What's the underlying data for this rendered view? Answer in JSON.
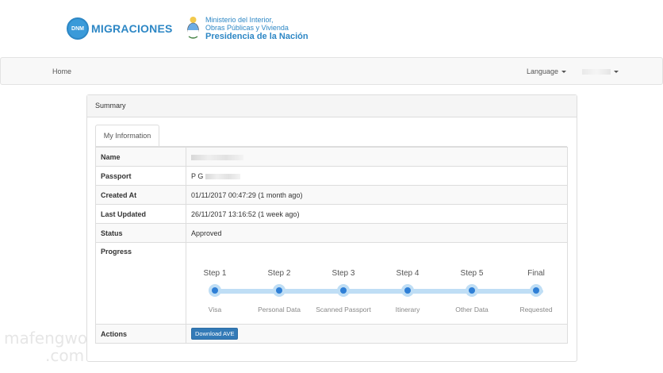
{
  "header": {
    "dnm_badge": "DNM",
    "dnm_name": "MIGRACIONES",
    "ministry_line1": "Ministerio del Interior,",
    "ministry_line2": "Obras Públicas y Vivienda",
    "ministry_line3": "Presidencia de la Nación"
  },
  "nav": {
    "home": "Home",
    "language": "Language"
  },
  "panel": {
    "title": "Summary",
    "tab": "My Information"
  },
  "info": {
    "name_label": "Name",
    "passport_label": "Passport",
    "passport_value": "P G",
    "created_label": "Created At",
    "created_value": "01/11/2017 00:47:29 (1 month ago)",
    "updated_label": "Last Updated",
    "updated_value": "26/11/2017 13:16:52 (1 week ago)",
    "status_label": "Status",
    "status_value": "Approved",
    "progress_label": "Progress",
    "actions_label": "Actions",
    "download_label": "Download AVE"
  },
  "progress_steps": [
    {
      "title": "Step 1",
      "sub": "Visa"
    },
    {
      "title": "Step 2",
      "sub": "Personal Data"
    },
    {
      "title": "Step 3",
      "sub": "Scanned Passport"
    },
    {
      "title": "Step 4",
      "sub": "Itinerary"
    },
    {
      "title": "Step 5",
      "sub": "Other Data"
    },
    {
      "title": "Final",
      "sub": "Requested"
    }
  ],
  "watermark": {
    "line1": "mafengwo",
    "line2": ".com"
  },
  "colors": {
    "brand_blue": "#2d87c5",
    "progress_track": "#bfdef5",
    "progress_dot": "#2f7fd6",
    "button": "#337ab7"
  }
}
